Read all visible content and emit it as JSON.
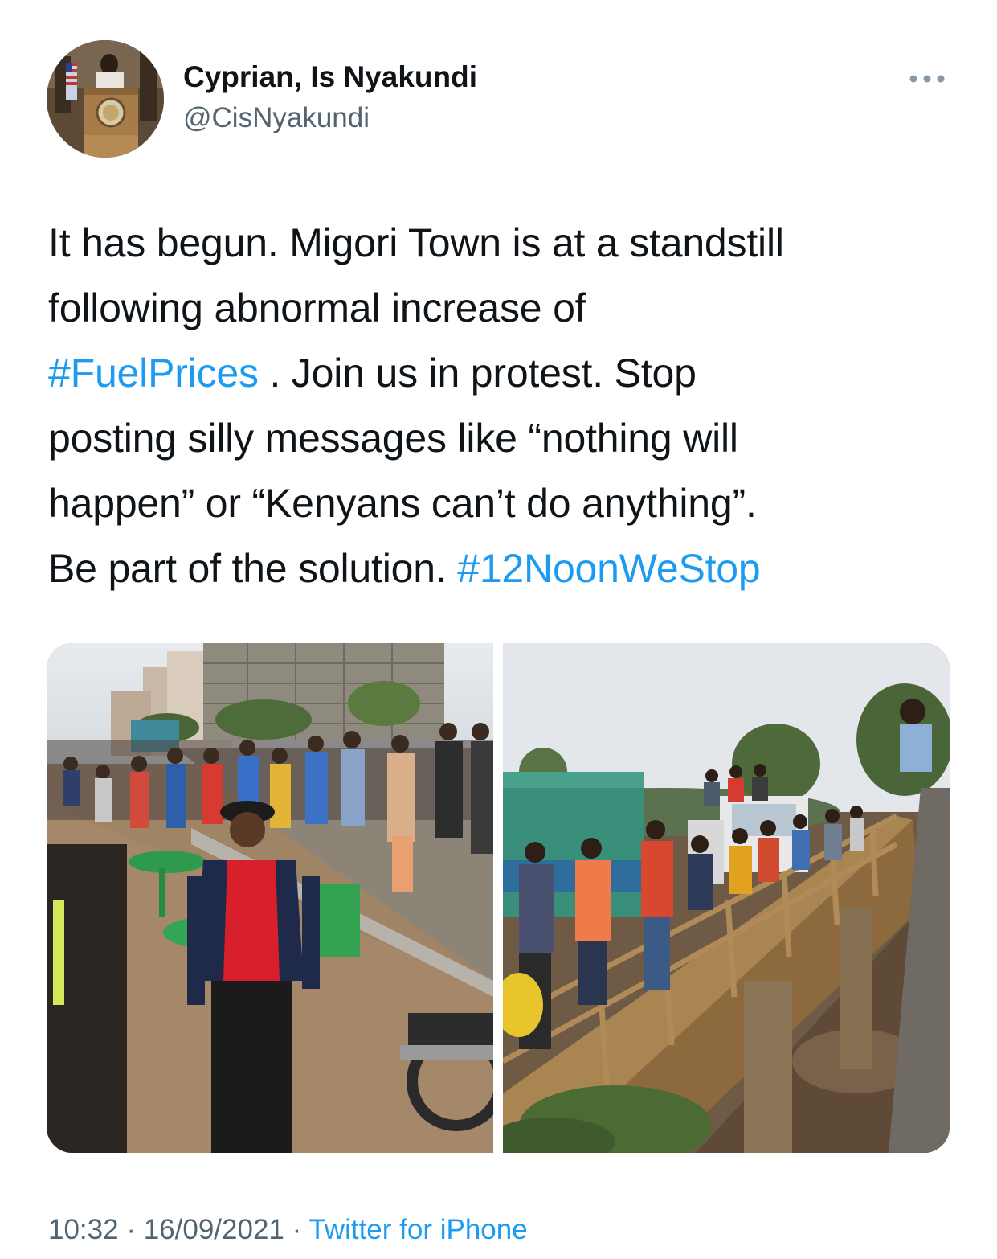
{
  "tweet": {
    "author": {
      "display_name": "Cyprian, Is Nyakundi",
      "handle": "@CisNyakundi",
      "avatar_icon": "avatar-podium-photo"
    },
    "more_icon": "more-horizontal-icon",
    "text_lines": [
      [
        {
          "text": "It has begun. Migori Town is at a standstill",
          "hashtag": false
        }
      ],
      [
        {
          "text": "following abnormal increase of",
          "hashtag": false
        }
      ],
      [
        {
          "text": "#FuelPrices",
          "hashtag": true
        },
        {
          "text": " . Join us in protest. Stop",
          "hashtag": false
        }
      ],
      [
        {
          "text": "posting silly messages like “nothing will",
          "hashtag": false
        }
      ],
      [
        {
          "text": "happen” or “Kenyans can’t do anything”.",
          "hashtag": false
        }
      ],
      [
        {
          "text": "Be part of the solution. ",
          "hashtag": false
        },
        {
          "text": "#12NoonWeStop",
          "hashtag": true
        }
      ]
    ],
    "media": [
      {
        "kind": "photo",
        "subject": "crowd-on-street-photo"
      },
      {
        "kind": "photo",
        "subject": "crowd-on-bridge-photo"
      }
    ],
    "meta": {
      "time": "10:32",
      "separator": " · ",
      "date": "16/09/2021",
      "source": "Twitter for iPhone"
    }
  },
  "colors": {
    "text": "#0f1419",
    "secondary": "#536471",
    "link": "#1d9bf0",
    "background": "#ffffff"
  }
}
